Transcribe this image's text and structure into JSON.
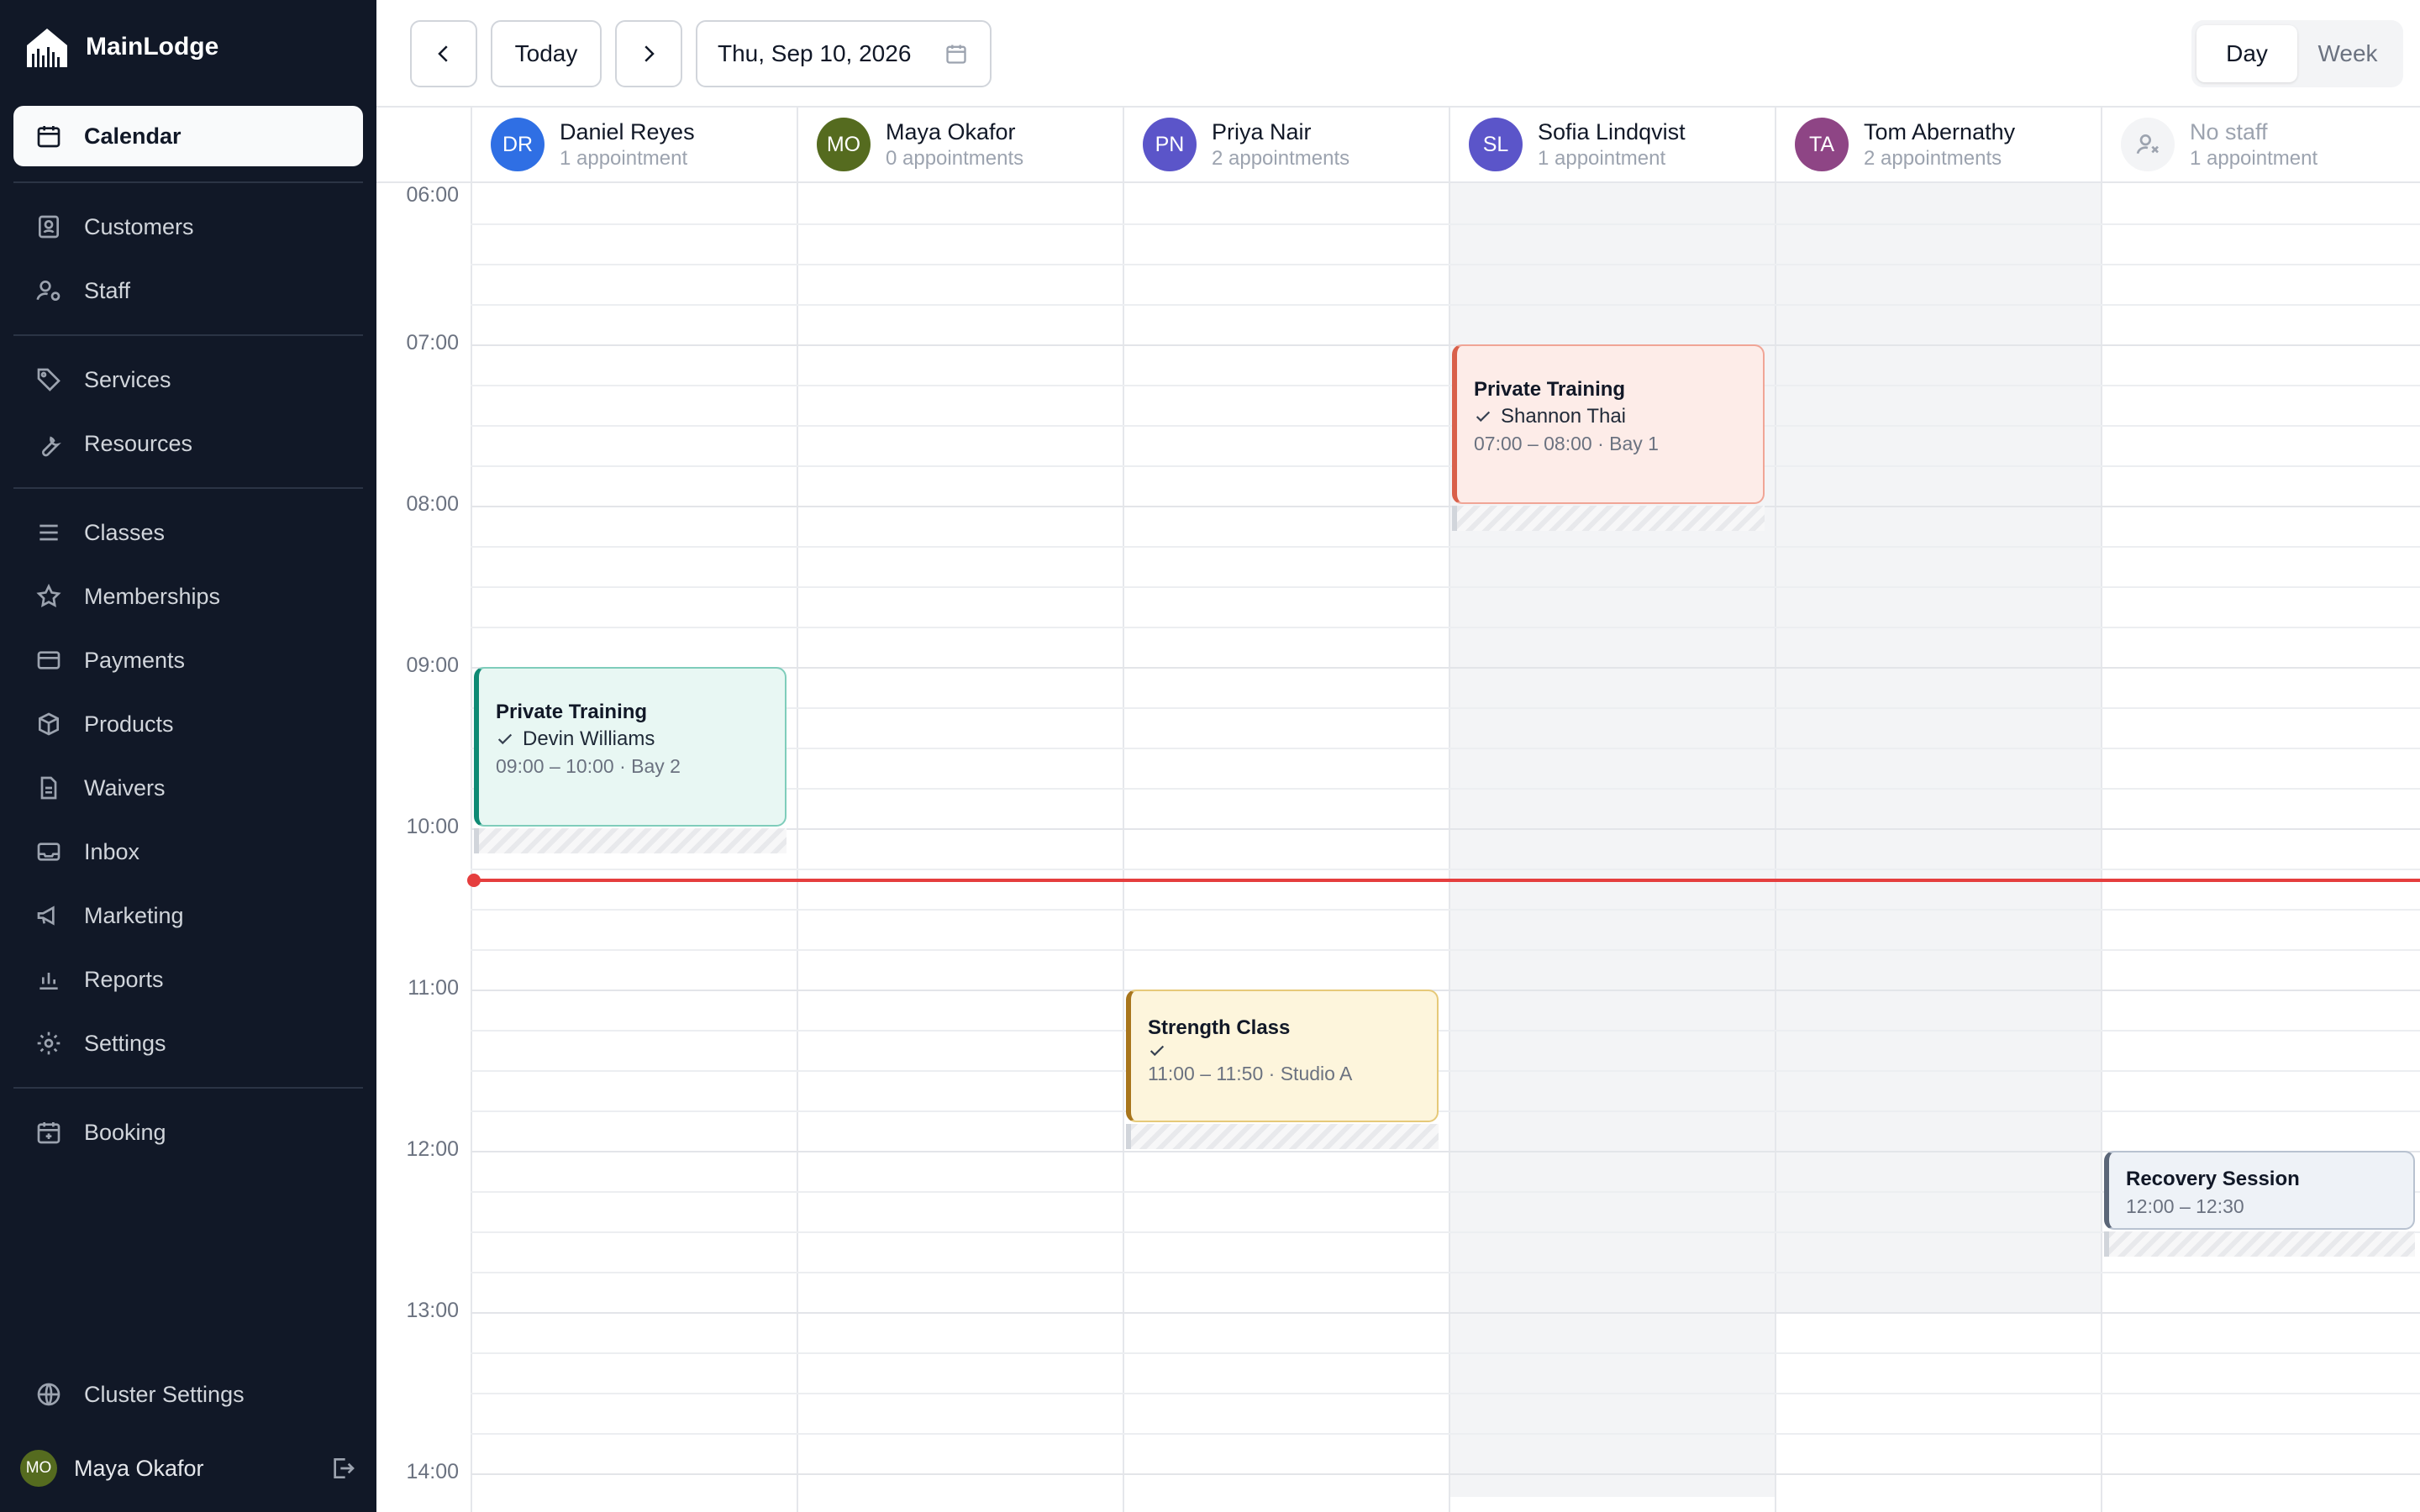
{
  "app": {
    "name": "MainLodge"
  },
  "sidebar": {
    "active": "Calendar",
    "items": [
      {
        "label": "Calendar",
        "icon": "calendar-icon"
      },
      {
        "label": "Customers",
        "icon": "id-badge-icon"
      },
      {
        "label": "Staff",
        "icon": "user-cog-icon"
      },
      {
        "label": "Services",
        "icon": "tag-icon"
      },
      {
        "label": "Resources",
        "icon": "wrench-icon"
      },
      {
        "label": "Classes",
        "icon": "list-icon"
      },
      {
        "label": "Memberships",
        "icon": "star-icon"
      },
      {
        "label": "Payments",
        "icon": "credit-card-icon"
      },
      {
        "label": "Products",
        "icon": "box-icon"
      },
      {
        "label": "Waivers",
        "icon": "document-icon"
      },
      {
        "label": "Inbox",
        "icon": "inbox-icon"
      },
      {
        "label": "Marketing",
        "icon": "megaphone-icon"
      },
      {
        "label": "Reports",
        "icon": "bar-chart-icon"
      },
      {
        "label": "Settings",
        "icon": "gear-icon"
      },
      {
        "label": "Booking",
        "icon": "calendar-plus-icon"
      }
    ],
    "footer": {
      "cluster_settings": "Cluster Settings",
      "cluster_icon": "globe-icon",
      "user_initials": "MO",
      "user_name": "Maya Okafor",
      "logout_icon": "logout-icon"
    }
  },
  "toolbar": {
    "prev_icon": "chevron-left-icon",
    "today": "Today",
    "next_icon": "chevron-right-icon",
    "date": "Thu, Sep 10, 2026",
    "date_icon": "calendar-icon",
    "views": [
      "Day",
      "Week"
    ],
    "active_view": "Day"
  },
  "columns": [
    {
      "initials": "DR",
      "name": "Daniel Reyes",
      "count": "1 appointment",
      "color": "#2f6fe4"
    },
    {
      "initials": "MO",
      "name": "Maya Okafor",
      "count": "0 appointments",
      "color": "#556b1f"
    },
    {
      "initials": "PN",
      "name": "Priya Nair",
      "count": "2 appointments",
      "color": "#5b55c9"
    },
    {
      "initials": "SL",
      "name": "Sofia Lindqvist",
      "count": "1 appointment",
      "color": "#5b55c9"
    },
    {
      "initials": "TA",
      "name": "Tom Abernathy",
      "count": "2 appointments",
      "color": "#8e4585"
    },
    {
      "initials": "",
      "name": "No staff",
      "count": "1 appointment",
      "color": "#f3f4f6",
      "icon": "user-x-icon"
    }
  ],
  "times": [
    "06:00",
    "07:00",
    "08:00",
    "09:00",
    "10:00",
    "11:00",
    "12:00",
    "13:00",
    "14:00"
  ],
  "appointments": [
    {
      "column": 0,
      "title": "Private Training",
      "client": "Devin Williams",
      "time": "09:00 – 10:00",
      "location": "Bay 2",
      "meta": "09:00 – 10:00 · Bay 2",
      "bg": "#e8f7f3",
      "border": "#7fcdbb",
      "accent": "#0f8a74",
      "confirmed": true
    },
    {
      "column": 2,
      "title": "Strength Class",
      "client": "",
      "time": "11:00 – 11:50",
      "location": "Studio A",
      "meta": "11:00 – 11:50 · Studio A",
      "bg": "#fdf5dc",
      "border": "#e6c979",
      "accent": "#a8751b",
      "confirmed": true
    },
    {
      "column": 3,
      "title": "Private Training",
      "client": "Shannon Thai",
      "time": "07:00 – 08:00",
      "location": "Bay 1",
      "meta": "07:00 – 08:00 · Bay 1",
      "bg": "#fdece8",
      "border": "#f0a596",
      "accent": "#d9604a",
      "confirmed": true
    },
    {
      "column": 5,
      "title": "Recovery Session",
      "client": "",
      "time": "12:00 – 12:30",
      "location": "",
      "meta": "12:00 – 12:30",
      "bg": "#eef2f7",
      "border": "#b8c2d0",
      "accent": "#5b6678",
      "confirmed": false
    }
  ],
  "now_time": "10:20",
  "colors": {
    "sidebar_bg": "#111827",
    "now_line": "#e53e3e",
    "off_hours": "#f3f4f6"
  }
}
